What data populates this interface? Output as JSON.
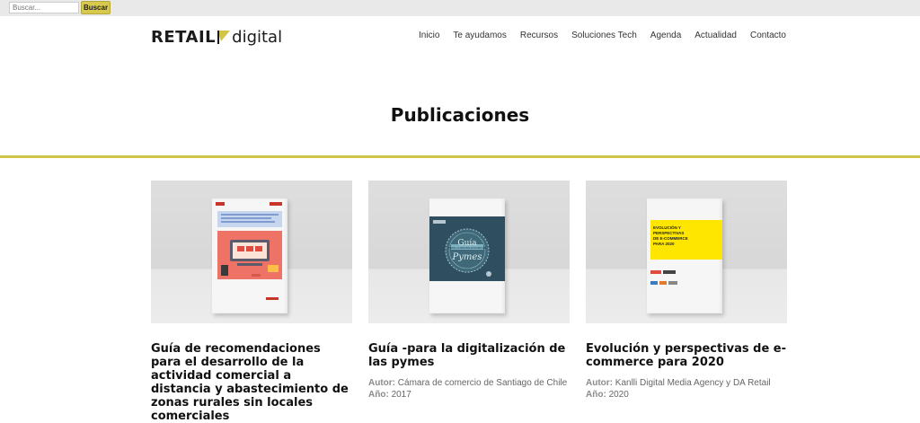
{
  "topbar": {
    "search_placeholder": "Buscar...",
    "search_button": "Buscar"
  },
  "logo": {
    "strong": "RETAIL",
    "light": "digital"
  },
  "nav": [
    "Inicio",
    "Te ayudamos",
    "Recursos",
    "Soluciones Tech",
    "Agenda",
    "Actualidad",
    "Contacto"
  ],
  "page_title": "Publicaciones",
  "colors": {
    "accent": "#d2c449",
    "button": "#d7c94d"
  },
  "cards": [
    {
      "title": "Guía de recomendaciones para el desarrollo de la actividad comercial a distancia y abastecimiento de zonas rurales sin locales comerciales"
    },
    {
      "title": "Guía -para la digitalización de las pymes",
      "author_label": "Autor:",
      "author": "Cámara de comercio de Santiago de Chile",
      "year_label": "Año:",
      "year": "2017",
      "cover_text": {
        "line1": "Guía",
        "line2": "PARA LA DIGITALIZACIÓN DE",
        "line3": "Pymes"
      }
    },
    {
      "title": "Evolución y perspectivas de e-commerce para 2020",
      "author_label": "Autor:",
      "author": "Kanlli Digital Media Agency y DA Retail",
      "year_label": "Año:",
      "year": "2020",
      "cover_text": {
        "line1": "EVOLUCIÓN Y",
        "line2": "PERSPECTIVAS",
        "line3": "DE E-COMMERCE",
        "line4": "PARA 2020"
      }
    }
  ]
}
